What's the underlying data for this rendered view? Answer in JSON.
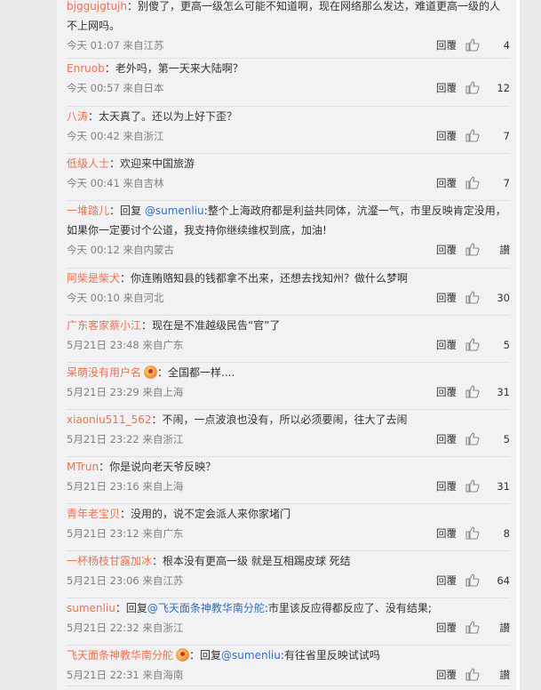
{
  "comments": [
    {
      "user": "bjggujgtujh",
      "text": "：别傻了，更高一级怎么可能不知道啊，现在网络那么发达，难道更高一级的人不上网吗。",
      "time": "今天 01:07 来自江苏",
      "reply": "回覆",
      "likes": "4"
    },
    {
      "user": "Enruob",
      "text": "：老外吗，第一天来大陆啊？",
      "time": "今天 00:57 来自日本",
      "reply": "回覆",
      "likes": "12"
    },
    {
      "user": "八涛",
      "text": "：太天真了。还以为上好下歪？",
      "time": "今天 00:42 来自浙江",
      "reply": "回覆",
      "likes": "7"
    },
    {
      "user": "低级人士",
      "text": "：欢迎来中国旅游",
      "time": "今天 00:41 来自吉林",
      "reply": "回覆",
      "likes": "7"
    },
    {
      "user": "一堆踏儿",
      "pre": "：回复 ",
      "mention": "@sumenliu",
      "text": ":整个上海政府都是利益共同体，沆瀣一气，市里反映肯定没用，如果你一定要讨个公道，我支持你继续维权到底，加油!",
      "time": "今天 00:12 来自内蒙古",
      "reply": "回覆",
      "likes": "讃"
    },
    {
      "user": "阿柴是柴犬",
      "text": "：你连贿赂知县的钱都拿不出来，还想去找知州？做什么梦啊",
      "time": "今天 00:10 来自河北",
      "reply": "回覆",
      "likes": "30"
    },
    {
      "user": "广东客家蔡小江",
      "text": "：现在是不准越级民告“官”了",
      "time": "5月21日 23:48 来自广东",
      "reply": "回覆",
      "likes": "5"
    },
    {
      "user": "呆萌没有用户名",
      "badge": true,
      "text": "：全国都一样....",
      "time": "5月21日 23:29 来自上海",
      "reply": "回覆",
      "likes": "31"
    },
    {
      "user": "xiaoniu511_562",
      "text": "：不闹，一点波浪也没有，所以必须要闹，往大了去闹",
      "time": "5月21日 23:22 来自浙江",
      "reply": "回覆",
      "likes": "5"
    },
    {
      "user": "MTrun",
      "text": "：你是说向老天爷反映？",
      "time": "5月21日 23:16 来自上海",
      "reply": "回覆",
      "likes": "31"
    },
    {
      "user": "青年老宝贝",
      "text": "：没用的，说不定会派人来你家堵门",
      "time": "5月21日 23:12 来自广东",
      "reply": "回覆",
      "likes": "8"
    },
    {
      "user": "一杯杨枝甘露加冰",
      "text": "：根本没有更高一级 就是互相踢皮球 死结",
      "time": "5月21日 23:06 来自江苏",
      "reply": "回覆",
      "likes": "64"
    },
    {
      "user": "sumenliu",
      "pre": "：回复",
      "mention": "@飞天面条神教华南分舵",
      "text": ":市里该反应得都反应了、没有结果;",
      "time": "5月21日 22:32 来自浙江",
      "reply": "回覆",
      "likes": "讃"
    },
    {
      "user": "飞天面条神教华南分舵",
      "badge": true,
      "pre": "：回复",
      "mention": "@sumenliu",
      "text": ":有往省里反映试试吗",
      "time": "5月21日 22:31 来自海南",
      "reply": "回覆",
      "likes": "讃"
    }
  ]
}
